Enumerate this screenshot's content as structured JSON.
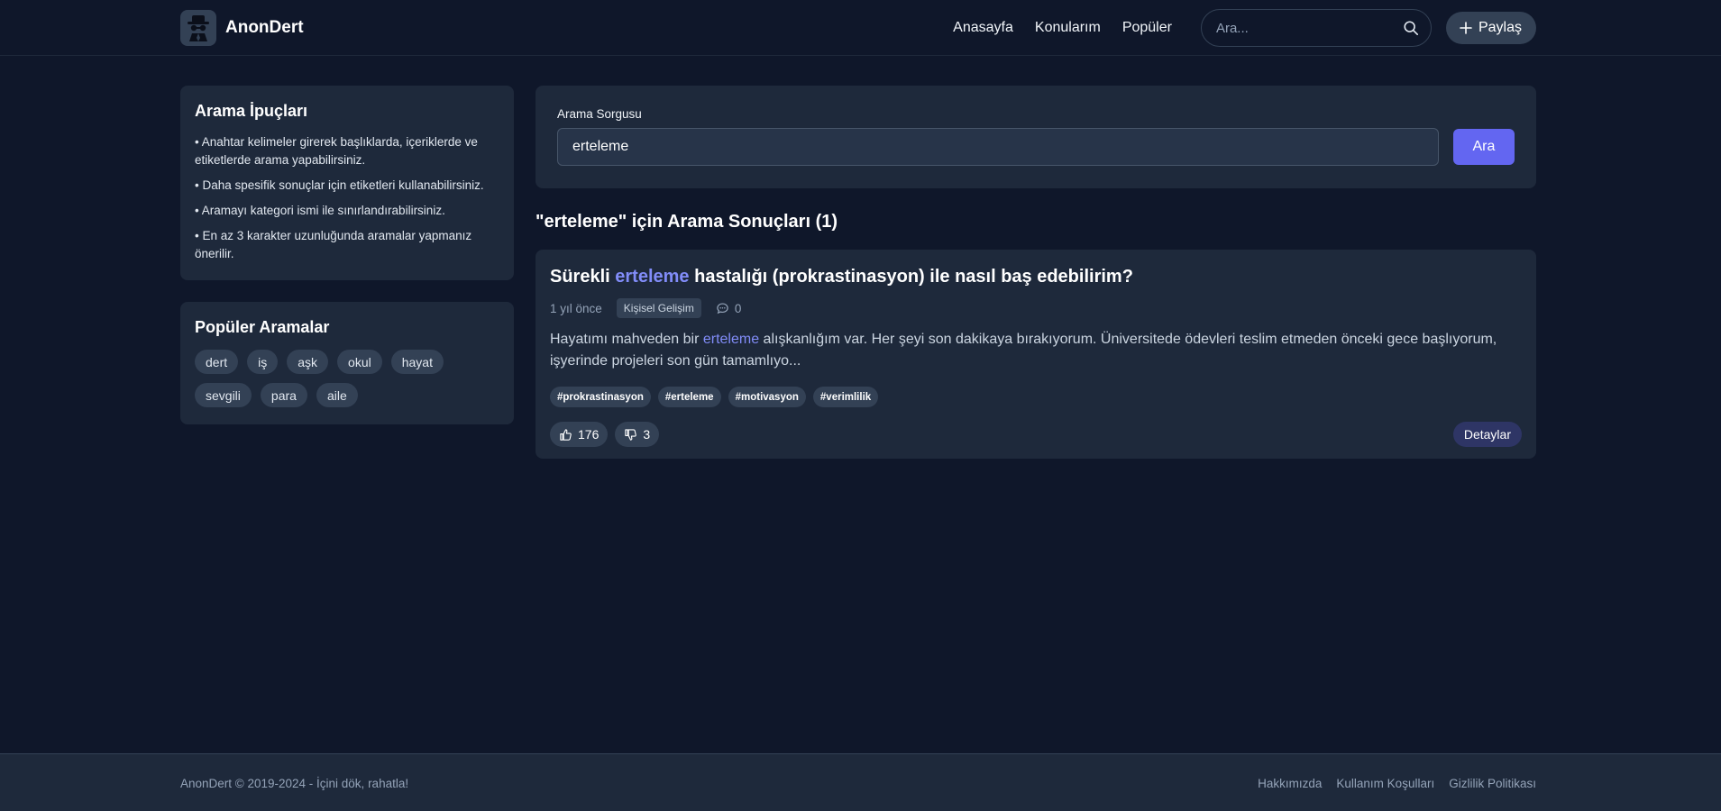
{
  "header": {
    "brand": "AnonDert",
    "nav": [
      "Anasayfa",
      "Konularım",
      "Popüler"
    ],
    "search_placeholder": "Ara...",
    "share_label": "Paylaş"
  },
  "sidebar": {
    "tips_title": "Arama İpuçları",
    "tips": [
      "• Anahtar kelimeler girerek başlıklarda, içeriklerde ve etiketlerde arama yapabilirsiniz.",
      "• Daha spesifik sonuçlar için etiketleri kullanabilirsiniz.",
      "• Aramayı kategori ismi ile sınırlandırabilirsiniz.",
      "• En az 3 karakter uzunluğunda aramalar yapmanız önerilir."
    ],
    "popular_title": "Popüler Aramalar",
    "popular": [
      "dert",
      "iş",
      "aşk",
      "okul",
      "hayat",
      "sevgili",
      "para",
      "aile"
    ]
  },
  "query": {
    "label": "Arama Sorgusu",
    "value": "erteleme",
    "button": "Ara"
  },
  "results": {
    "title": "\"erteleme\" için Arama Sonuçları (1)",
    "items": [
      {
        "title_before": "Sürekli ",
        "title_highlight": "erteleme",
        "title_after": " hastalığı (prokrastinasyon) ile nasıl baş edebilirim?",
        "time": "1 yıl önce",
        "category": "Kişisel Gelişim",
        "comments": "0",
        "excerpt_before": "Hayatımı mahveden bir ",
        "excerpt_highlight": "erteleme",
        "excerpt_after": " alışkanlığım var. Her şeyi son dakikaya bırakıyorum. Üniversitede ödevleri teslim etmeden önceki gece başlıyorum, işyerinde projeleri son gün tamamlıyo...",
        "tags": [
          "#prokrastinasyon",
          "#erteleme",
          "#motivasyon",
          "#verimlilik"
        ],
        "likes": "176",
        "dislikes": "3",
        "details_label": "Detaylar"
      }
    ]
  },
  "footer": {
    "copyright": "AnonDert © 2019-2024 - İçini dök, rahatla!",
    "links": [
      "Hakkımızda",
      "Kullanım Koşulları",
      "Gizlilik Politikası"
    ]
  },
  "colors": {
    "background": "#0f172a",
    "card": "#1e293b",
    "accent": "#6366f1",
    "highlight": "#818cf8"
  },
  "icons": [
    "incognito-logo-icon",
    "search-icon",
    "plus-icon",
    "comment-icon",
    "thumbs-up-icon",
    "thumbs-down-icon"
  ]
}
